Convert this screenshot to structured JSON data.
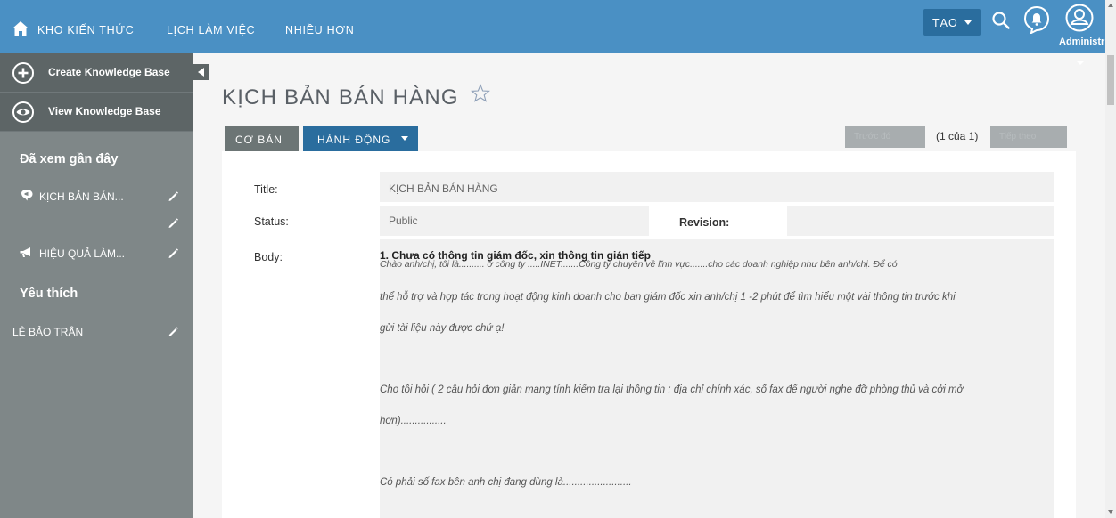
{
  "topnav": {
    "items": [
      "KHO KIẾN THỨC",
      "LỊCH LÀM VIỆC",
      "NHIỀU HƠN"
    ],
    "create_label": "TẠO",
    "user_label": "Administr"
  },
  "sidebar": {
    "actions": [
      "Create Knowledge Base",
      "View Knowledge Base"
    ],
    "recent_heading": "Đã xem gần đây",
    "recent_items": [
      "KỊCH BẢN BÁN...",
      "HIỆU QUẢ LÀM..."
    ],
    "favorites_heading": "Yêu thích",
    "favorite_items": [
      "LÊ BẢO TRÂN"
    ]
  },
  "main": {
    "title": "KỊCH BẢN BÁN HÀNG",
    "tabs": [
      "CƠ BẢN",
      "HÀNH ĐỘNG"
    ],
    "pager": {
      "prev_label": "Trước đó",
      "count": "(1 của 1)",
      "next_label": "Tiếp theo"
    },
    "fields": {
      "title_label": "Title:",
      "title_value": "KỊCH BẢN BÁN HÀNG",
      "status_label": "Status:",
      "status_value": "Public",
      "revision_label": "Revision:",
      "revision_value": "",
      "body_label": "Body:"
    },
    "body": {
      "heading": "1. Chưa có thông tin giám đốc, xin thông tin gián tiếp",
      "lines": [
        "Chào anh/chị, tôi là.......... ở công ty .....INET.......Công ty chuyên về lĩnh vực.......cho các doanh nghiệp như bên anh/chị. Để có",
        "thể hỗ trợ và hợp tác trong hoạt động kinh doanh cho ban giám đốc xin anh/chị 1 -2 phút để tìm hiểu một vài thông tin trước khi",
        "gửi tài liệu này được chứ ạ!",
        "Cho tôi hỏi ( 2 câu hỏi đơn giản mang tính kiểm tra lại thông tin : địa chỉ chính xác, số fax để người nghe đỡ phòng thủ và cởi mở",
        "hơn)................",
        "Có phải số fax bên anh chị đang dùng là........................"
      ]
    }
  },
  "colors": {
    "topbar": "#4a90c4",
    "accent": "#2a6d9e",
    "sidebar": "#7f8788",
    "sidebar_dark": "#5d6566"
  }
}
